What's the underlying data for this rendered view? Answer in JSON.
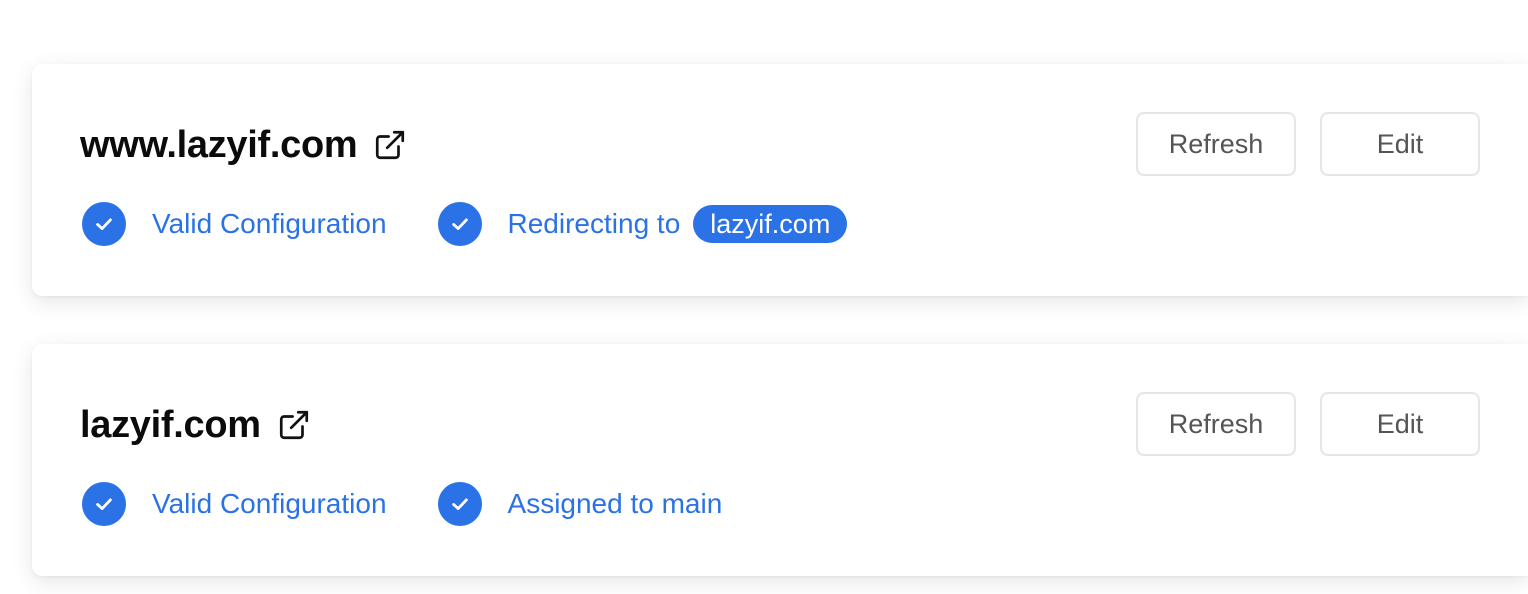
{
  "colors": {
    "accent": "#2a72e5",
    "title": "#0b0b0b",
    "button_text": "#555555",
    "button_border": "#e6e6e6"
  },
  "domains": [
    {
      "name": "www.lazyif.com",
      "external_link_icon": "external-link-icon",
      "buttons": {
        "refresh": "Refresh",
        "edit": "Edit"
      },
      "statuses": [
        {
          "icon": "check-circle-icon",
          "text": "Valid Configuration"
        },
        {
          "icon": "check-circle-icon",
          "text": "Redirecting to",
          "target": "lazyif.com"
        }
      ]
    },
    {
      "name": "lazyif.com",
      "external_link_icon": "external-link-icon",
      "buttons": {
        "refresh": "Refresh",
        "edit": "Edit"
      },
      "statuses": [
        {
          "icon": "check-circle-icon",
          "text": "Valid Configuration"
        },
        {
          "icon": "check-circle-icon",
          "text": "Assigned to main"
        }
      ]
    }
  ]
}
